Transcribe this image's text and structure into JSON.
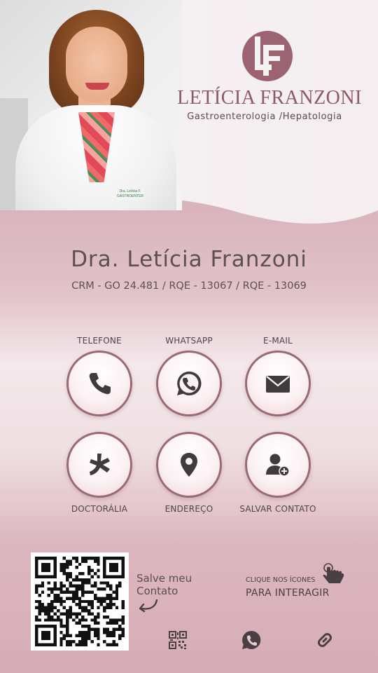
{
  "brand": {
    "name": "LETÍCIA FRANZONI",
    "specialty": "Gastroenterologia /Hepatologia",
    "logo_icon": "lf-monogram-icon",
    "accent_color": "#9a6a73"
  },
  "photo": {
    "badge_text": "Dra. Letícia F. GASTROENTER"
  },
  "profile": {
    "name": "Dra. Letícia Franzoni",
    "registration": "CRM - GO 24.481 / RQE - 13067 / RQE - 13069"
  },
  "actions": [
    {
      "label": "TELEFONE",
      "icon": "phone-icon"
    },
    {
      "label": "WHATSAPP",
      "icon": "whatsapp-icon"
    },
    {
      "label": "E-MAIL",
      "icon": "mail-icon"
    },
    {
      "label": "DOCTORÁLIA",
      "icon": "doctoralia-icon"
    },
    {
      "label": "ENDEREÇO",
      "icon": "location-pin-icon"
    },
    {
      "label": "SALVAR CONTATO",
      "icon": "add-contact-icon"
    }
  ],
  "bottom": {
    "save_line1": "Salve meu",
    "save_line2": "Contato",
    "hint_small": "CLIQUE NOS ÍCONES",
    "hint_big": "PARA INTERAGIR"
  },
  "footer_icons": [
    "qr-code-icon",
    "whatsapp-icon",
    "link-icon"
  ]
}
